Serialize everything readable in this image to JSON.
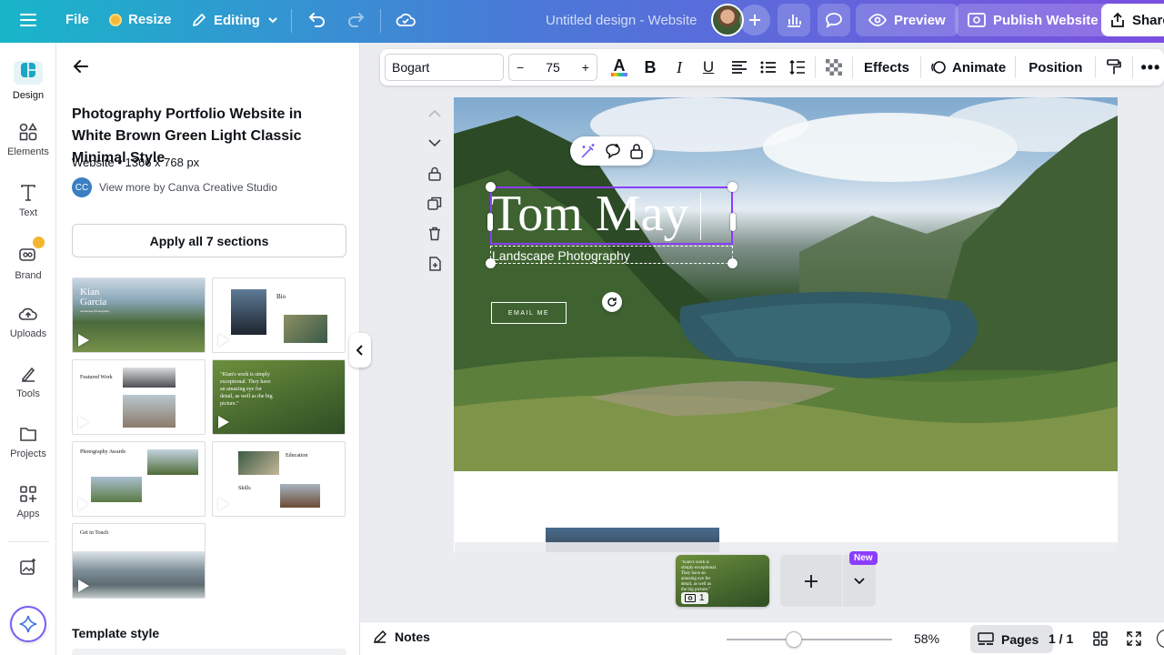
{
  "topbar": {
    "file": "File",
    "resize": "Resize",
    "editing": "Editing",
    "doc_title": "Untitled design - Website",
    "preview": "Preview",
    "publish": "Publish Website",
    "share": "Share"
  },
  "rail": {
    "design": "Design",
    "elements": "Elements",
    "text": "Text",
    "brand": "Brand",
    "uploads": "Uploads",
    "tools": "Tools",
    "projects": "Projects",
    "apps": "Apps"
  },
  "panel": {
    "title": "Photography Portfolio Website in White Brown Green Light Classic Minimal Style",
    "meta": "Website • 1366 x 768 px",
    "creator_initials": "CC",
    "creator": "View more by Canva Creative Studio",
    "apply_button": "Apply all 7 sections",
    "template_style": "Template style",
    "thumbs": {
      "t1_name": "Kian Garcia",
      "t1_sub": "Landscape Photography",
      "t2_heading": "Bio",
      "t3_heading": "Featured Work",
      "t4_quote": "\"Kian's work is simply exceptional. They have an amazing eye for detail, as well as the big picture.\"",
      "t5_heading": "Photography Awards",
      "t6_heading": "Education",
      "t6_heading2": "Skills",
      "t7_heading": "Get in Touch"
    }
  },
  "toolbar": {
    "font": "Bogart",
    "font_size": "75",
    "effects": "Effects",
    "animate": "Animate",
    "position": "Position"
  },
  "canvas": {
    "name": "Tom May",
    "subtitle": "Landscape Photography",
    "email_button": "EMAIL ME"
  },
  "pages_popup": {
    "page_number": "1",
    "new_badge": "New",
    "quote": "\"Kian's work is simply exceptional. They have an amazing eye for detail, as well as the big picture.\""
  },
  "bottombar": {
    "notes": "Notes",
    "zoom": "58%",
    "zoom_level": 0.58,
    "pages": "Pages",
    "page_count": "1 / 1"
  },
  "colors": {
    "accent": "#8b3dff",
    "topbar_start": "#19b5c9",
    "topbar_end": "#7b4fe0"
  }
}
